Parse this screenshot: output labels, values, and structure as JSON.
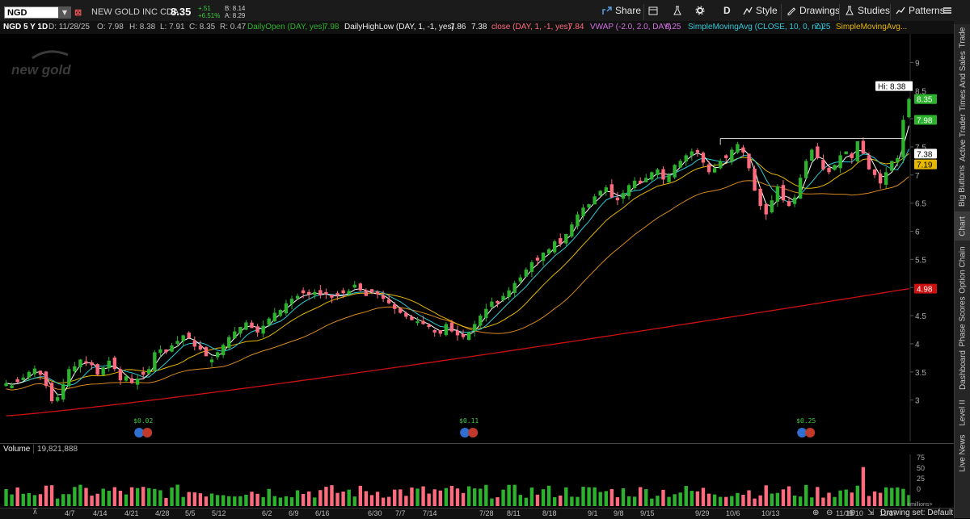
{
  "symbol_bar": {
    "symbol": "NGD",
    "company": "NEW GOLD INC CDA",
    "last": "8.35",
    "change": "+.51",
    "change_pct": "+6.51%",
    "bid": "B: 8.14",
    "ask": "A: 8.29"
  },
  "toolbar": {
    "share": "Share",
    "aggregation": "D",
    "style": "Style",
    "drawings": "Drawings",
    "studies": "Studies",
    "patterns": "Patterns"
  },
  "study_bar": {
    "chart_label": "NGD 5 Y 1D",
    "date": "D: 11/28/25",
    "open": "O: 7.98",
    "high": "H: 8.38",
    "low": "L: 7.91",
    "close": "C: 8.35",
    "range": "R: 0.47",
    "daily_open": "DailyOpen (DAY, yes)",
    "daily_open_val": "7.98",
    "daily_highlow": "DailyHighLow (DAY, 1, -1, yes)",
    "daily_high_val": "7.86",
    "daily_low_val": "7.38",
    "close_study": "close (DAY, 1, -1, yes)",
    "close_study_val": "7.84",
    "vwap": "VWAP (-2.0, 2.0, DAY)",
    "vwap_val": "8.25",
    "sma10": "SimpleMovingAvg (CLOSE, 10, 0, no)",
    "sma10_val": "7.25",
    "sma2": "SimpleMovingAvg..."
  },
  "volume": {
    "label": "Volume",
    "value": "19,821,888",
    "unit": "<millions>",
    "ticks": [
      "75",
      "50",
      "25",
      "0"
    ]
  },
  "footer": {
    "drawing_set": "Drawing set: Default"
  },
  "right_dock": [
    "Trade",
    "Times And Sales",
    "Active Trader",
    "Big Buttons",
    "Chart",
    "Option Chain",
    "Phase Scores",
    "Dashboard",
    "Level II",
    "Live News"
  ],
  "colors": {
    "up": "#2db22d",
    "down": "#ff6b7e",
    "sma_white": "#ffffff",
    "sma_cyan": "#2ec8d8",
    "sma_yellow": "#e6b800",
    "sma_orange": "#d98a20",
    "sma_red": "#cc1111",
    "resistance": "#d0d0d0"
  },
  "chart_data": {
    "type": "candlestick",
    "ylim": [
      2.65,
      9.25
    ],
    "yticks": [
      3,
      3.5,
      4,
      4.5,
      5,
      5.5,
      6,
      6.5,
      7,
      7.5,
      8,
      8.5,
      9
    ],
    "x_ticks": [
      "4/7",
      "4/14",
      "4/21",
      "4/28",
      "5/5",
      "5/12",
      "6/2",
      "6/9",
      "6/16",
      "6/30",
      "7/7",
      "7/14",
      "7/28",
      "8/11",
      "8/18",
      "9/1",
      "9/8",
      "9/15",
      "9/29",
      "10/6",
      "10/13",
      "11/3",
      "11/10",
      "11/17"
    ],
    "price_labels": [
      {
        "text": "Hi: 8.38",
        "value": 8.38
      },
      {
        "text": "8.35",
        "value": 8.35
      },
      {
        "text": "7.98",
        "value": 7.98
      },
      {
        "text": "7.38",
        "value": 7.38
      },
      {
        "text": "7.19",
        "value": 7.19
      },
      {
        "text": "4.98",
        "value": 4.98
      }
    ],
    "dividends": [
      {
        "text": "$0.02",
        "date": "4/28"
      },
      {
        "text": "$0.11",
        "date": "7/21"
      },
      {
        "text": "$0.25",
        "date": "10/27"
      }
    ],
    "resistance_level": 7.65,
    "closes": [
      3.3,
      3.26,
      3.32,
      3.4,
      3.5,
      3.56,
      3.45,
      3.25,
      2.98,
      3.05,
      3.28,
      3.55,
      3.6,
      3.72,
      3.65,
      3.62,
      3.45,
      3.58,
      3.7,
      3.55,
      3.35,
      3.42,
      3.3,
      3.38,
      3.45,
      3.55,
      3.85,
      3.9,
      3.85,
      3.97,
      4.05,
      4.15,
      4.1,
      3.95,
      3.9,
      3.78,
      3.72,
      3.85,
      3.98,
      4.12,
      4.22,
      4.3,
      4.38,
      4.28,
      4.2,
      4.32,
      4.45,
      4.55,
      4.6,
      4.72,
      4.8,
      4.85,
      4.9,
      4.88,
      4.92,
      4.86,
      4.88,
      4.82,
      4.85,
      4.9,
      4.94,
      5.05,
      4.95,
      4.85,
      4.92,
      4.88,
      4.8,
      4.72,
      4.62,
      4.55,
      4.48,
      4.42,
      4.4,
      4.35,
      4.3,
      4.2,
      4.18,
      4.35,
      4.22,
      4.15,
      4.12,
      4.2,
      4.35,
      4.5,
      4.62,
      4.75,
      4.72,
      4.85,
      4.95,
      5.08,
      5.18,
      5.32,
      5.45,
      5.48,
      5.62,
      5.68,
      5.82,
      5.78,
      5.95,
      6.12,
      6.3,
      6.42,
      6.48,
      6.62,
      6.72,
      6.78,
      6.6,
      6.55,
      6.68,
      6.82,
      6.9,
      6.85,
      6.95,
      7.05,
      7.1,
      6.92,
      7.0,
      7.18,
      7.25,
      7.35,
      7.42,
      7.4,
      7.22,
      7.05,
      7.12,
      7.25,
      7.3,
      7.45,
      7.55,
      7.4,
      7.12,
      6.72,
      6.45,
      6.3,
      6.55,
      6.8,
      6.55,
      6.45,
      6.6,
      6.95,
      7.25,
      7.45,
      7.3,
      7.1,
      7.05,
      7.18,
      7.35,
      7.42,
      7.3,
      7.6,
      7.38,
      7.1,
      7.0,
      6.85,
      7.05,
      7.25,
      7.3,
      7.98,
      8.35
    ]
  }
}
